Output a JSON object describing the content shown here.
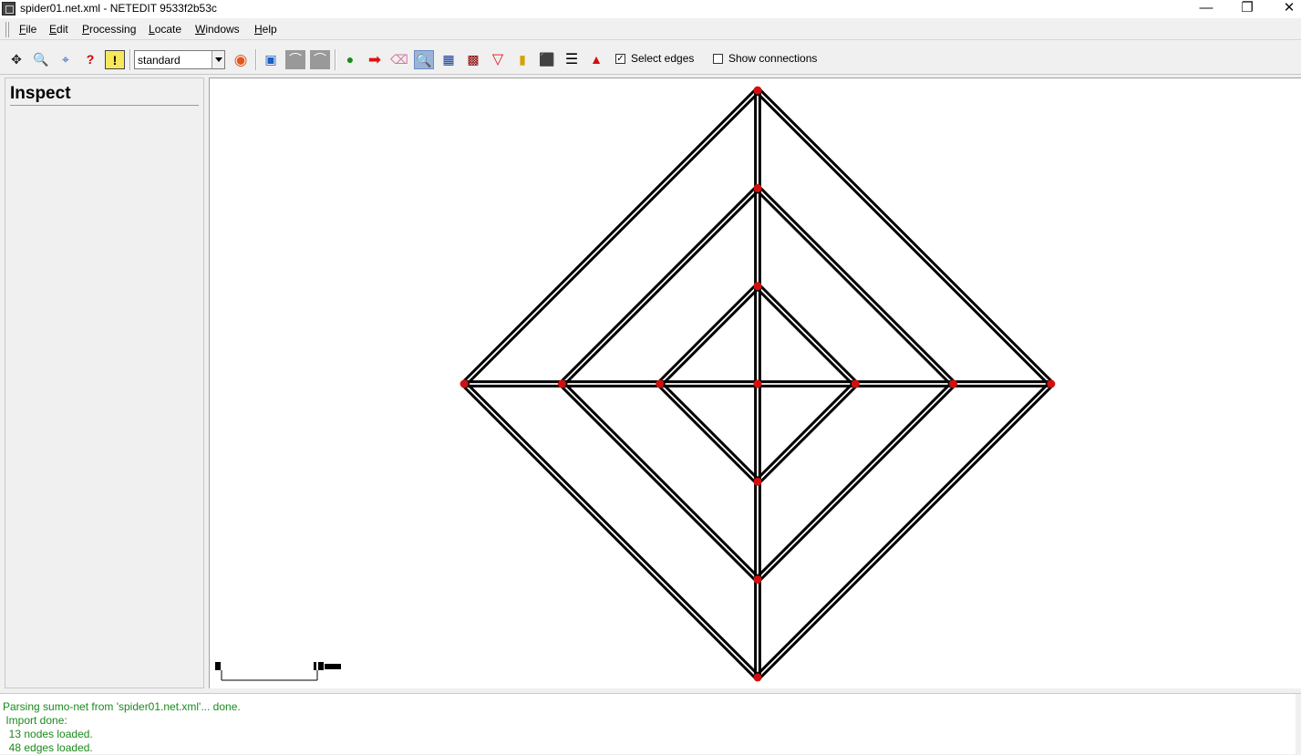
{
  "window": {
    "title": "spider01.net.xml - NETEDIT 9533f2b53c",
    "minimize_glyph": "—",
    "restore_glyph": "❐",
    "close_glyph": "✕"
  },
  "menu": [
    {
      "key": "F",
      "rest": "ile"
    },
    {
      "key": "E",
      "rest": "dit"
    },
    {
      "key": "P",
      "rest": "rocessing"
    },
    {
      "key": "L",
      "rest": "ocate"
    },
    {
      "key": "W",
      "rest": "indows"
    },
    {
      "key": "H",
      "rest": "elp"
    }
  ],
  "toolbar": {
    "scheme": "standard",
    "select_edges_label": "Select edges",
    "select_edges_checked": "✓",
    "show_connections_label": "Show connections",
    "icons": {
      "recenter": "✥",
      "locate": "🔍",
      "pick": "⌖",
      "help": "?",
      "tooltip": "!",
      "color": "◉",
      "screenshot": "▣",
      "undo": "⌒",
      "redo": "⌒",
      "create-edge": "●",
      "move": "➡",
      "delete": "⌫",
      "inspect": "🔍",
      "select": "▦",
      "crossing": "▩",
      "prohibit": "▽",
      "tls": "▮",
      "additional": "⬛",
      "connect": "☰",
      "shape": "▲"
    }
  },
  "inspect": {
    "title": "Inspect"
  },
  "network": {
    "node_color": "#d01010",
    "edge_color": "#000000",
    "nodes": [
      {
        "id": "n0",
        "x": 0,
        "y": 3
      },
      {
        "id": "n1",
        "x": 0,
        "y": 2
      },
      {
        "id": "n2",
        "x": 0,
        "y": 1
      },
      {
        "id": "n3",
        "x": 0,
        "y": 0
      },
      {
        "id": "n4",
        "x": 0,
        "y": -1
      },
      {
        "id": "n5",
        "x": 0,
        "y": -2
      },
      {
        "id": "n6",
        "x": 0,
        "y": -3
      },
      {
        "id": "n7",
        "x": -3,
        "y": 0
      },
      {
        "id": "n8",
        "x": -2,
        "y": 0
      },
      {
        "id": "n9",
        "x": -1,
        "y": 0
      },
      {
        "id": "n10",
        "x": 1,
        "y": 0
      },
      {
        "id": "n11",
        "x": 2,
        "y": 0
      },
      {
        "id": "n12",
        "x": 3,
        "y": 0
      }
    ],
    "edges": [
      [
        "n0",
        "n1"
      ],
      [
        "n1",
        "n2"
      ],
      [
        "n2",
        "n3"
      ],
      [
        "n3",
        "n4"
      ],
      [
        "n4",
        "n5"
      ],
      [
        "n5",
        "n6"
      ],
      [
        "n7",
        "n8"
      ],
      [
        "n8",
        "n9"
      ],
      [
        "n9",
        "n3"
      ],
      [
        "n3",
        "n10"
      ],
      [
        "n10",
        "n11"
      ],
      [
        "n11",
        "n12"
      ],
      [
        "n0",
        "n7"
      ],
      [
        "n0",
        "n12"
      ],
      [
        "n6",
        "n7"
      ],
      [
        "n6",
        "n12"
      ],
      [
        "n1",
        "n8"
      ],
      [
        "n1",
        "n11"
      ],
      [
        "n5",
        "n8"
      ],
      [
        "n5",
        "n11"
      ],
      [
        "n2",
        "n9"
      ],
      [
        "n2",
        "n10"
      ],
      [
        "n4",
        "n9"
      ],
      [
        "n4",
        "n10"
      ]
    ]
  },
  "console": {
    "lines": [
      "Parsing sumo-net from 'spider01.net.xml'... done.",
      " Import done:",
      "  13 nodes loaded.",
      "  48 edges loaded."
    ]
  }
}
